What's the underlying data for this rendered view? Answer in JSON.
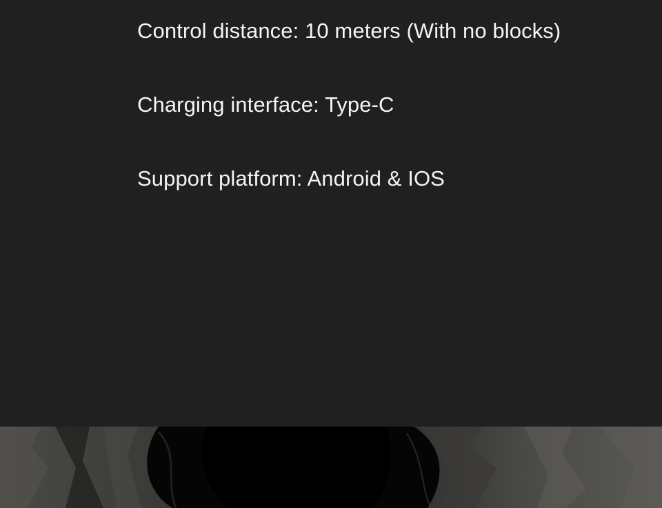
{
  "specs": {
    "items": [
      "Control distance: 10 meters (With no blocks)",
      "Charging interface: Type-C",
      "Support platform: Android & IOS"
    ]
  },
  "theme": {
    "background": "#202020",
    "text": "#f4f4f4"
  }
}
